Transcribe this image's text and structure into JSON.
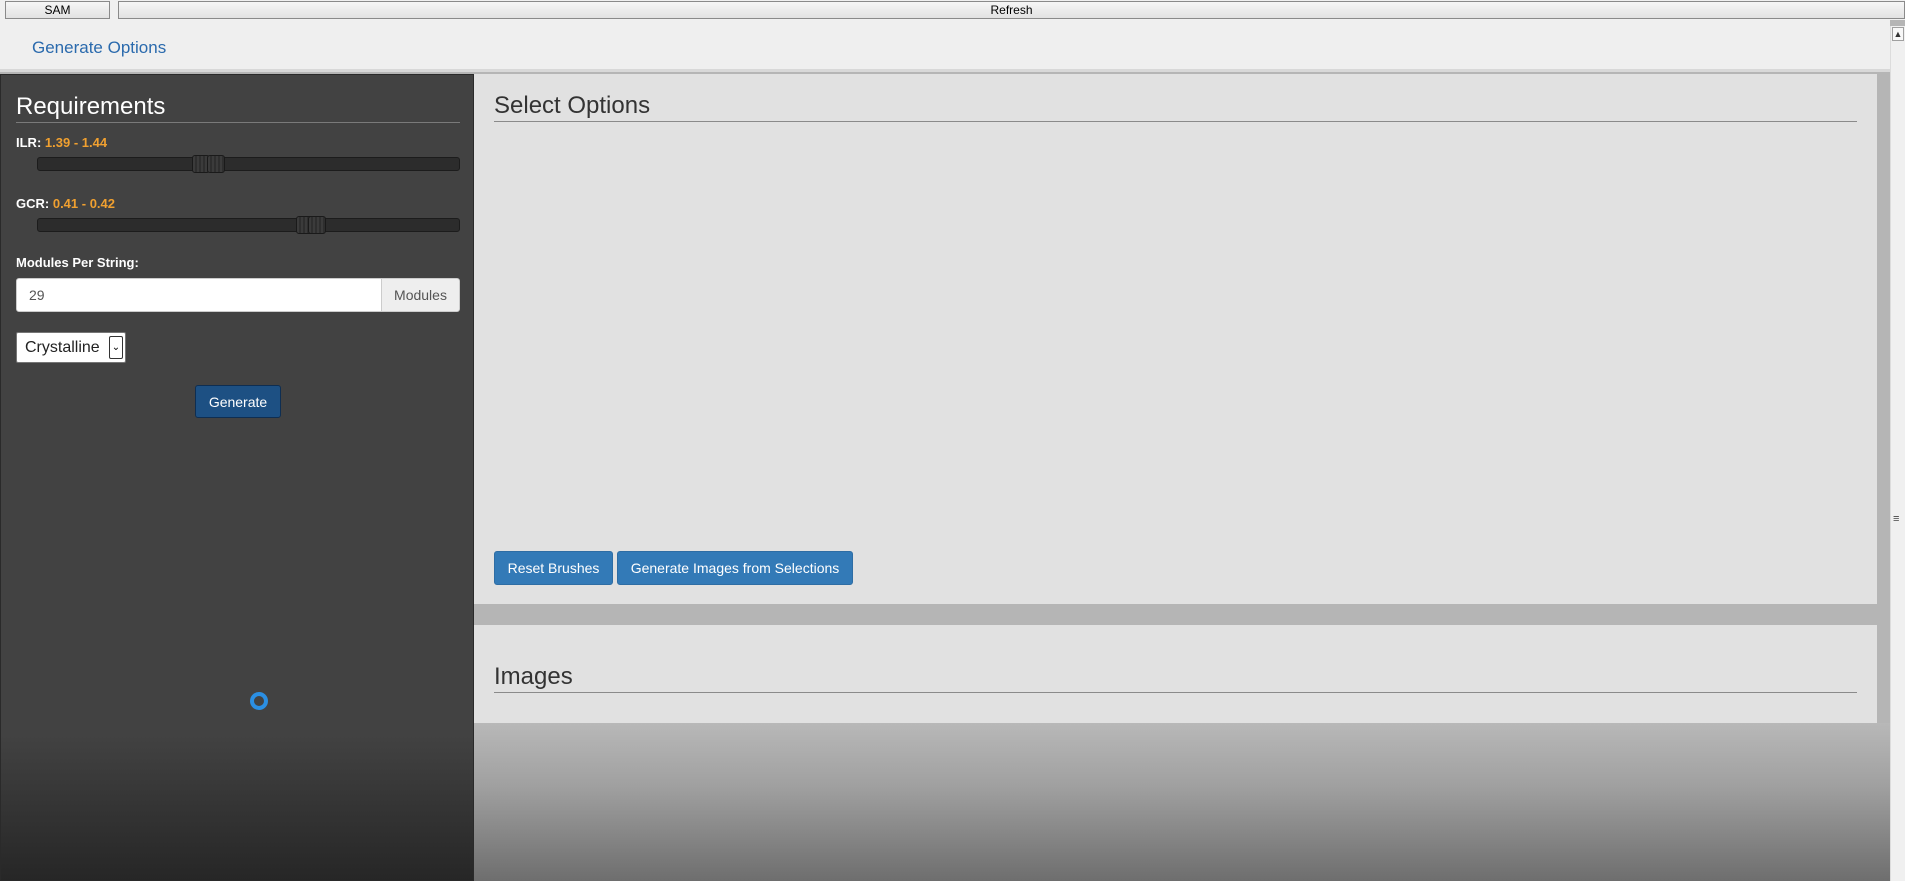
{
  "toolbar": {
    "sam_label": "SAM",
    "refresh_label": "Refresh"
  },
  "header": {
    "nav_link": "Generate Options"
  },
  "requirements": {
    "title": "Requirements",
    "ilr": {
      "label": "ILR:",
      "value": "1.39 - 1.44",
      "range_fraction": [
        0.39,
        0.44
      ]
    },
    "gcr": {
      "label": "GCR:",
      "value": "0.41 - 0.42",
      "range_fraction": [
        0.66,
        0.68
      ]
    },
    "modules_per_string": {
      "label": "Modules Per String:",
      "value": "29",
      "addon": "Modules"
    },
    "technology_select": {
      "selected": "Crystalline"
    },
    "generate_label": "Generate"
  },
  "select_options": {
    "title": "Select Options",
    "reset_label": "Reset Brushes",
    "generate_images_label": "Generate Images from Selections"
  },
  "images": {
    "title": "Images"
  },
  "colors": {
    "accent_value": "#f0a030",
    "primary_button": "#337ab7",
    "generate_button": "#1d5083",
    "spinner": "#2b8fe3"
  }
}
